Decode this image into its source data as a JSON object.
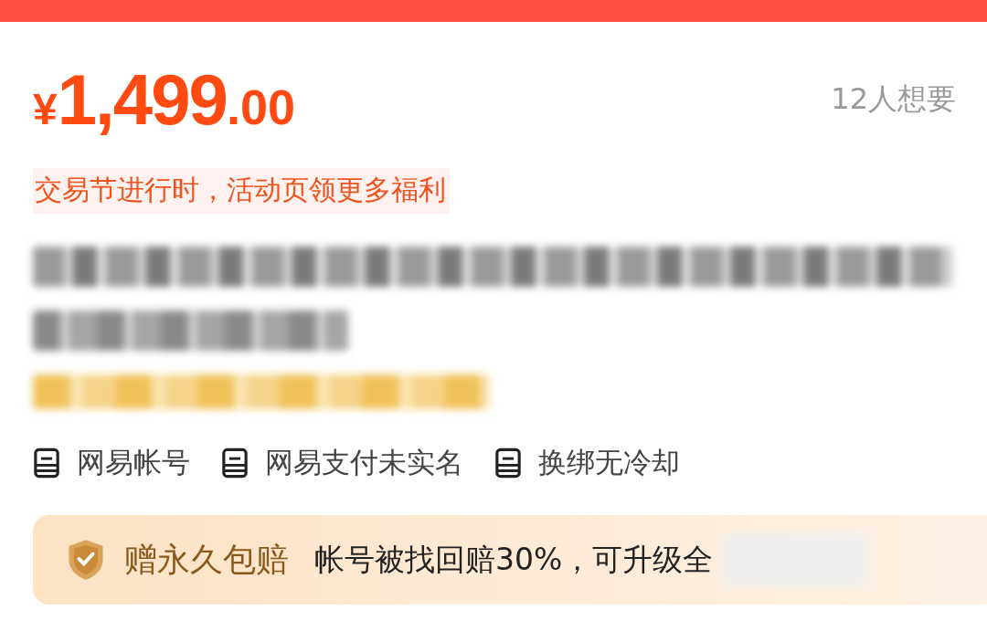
{
  "price": {
    "currency": "¥",
    "integer": "1,499",
    "decimal": ".00"
  },
  "wants": "12人想要",
  "promo": "交易节进行时，活动页领更多福利",
  "tags": [
    {
      "label": "网易帐号"
    },
    {
      "label": "网易支付未实名"
    },
    {
      "label": "换绑无冷却"
    }
  ],
  "guarantee": {
    "title": "赠永久包赔",
    "text": "帐号被找回赔30%，可升级全"
  }
}
